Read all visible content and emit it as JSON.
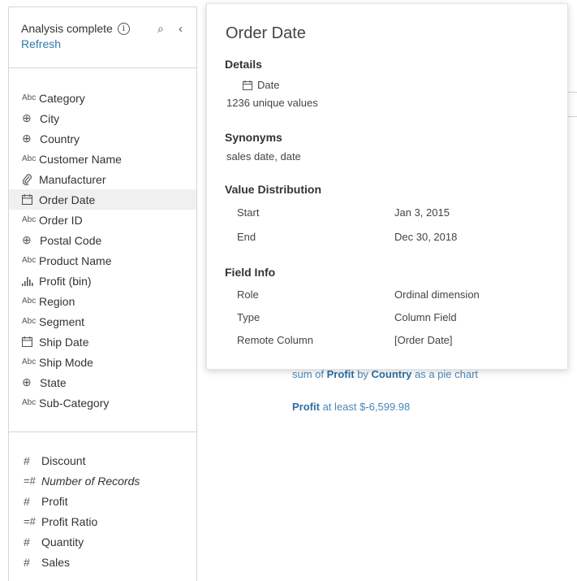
{
  "header": {
    "status": "Analysis complete",
    "refresh_label": "Refresh",
    "icons": [
      "info-icon",
      "search-icon",
      "collapse-icon"
    ]
  },
  "dimensions": [
    {
      "type": "abc",
      "label": "Category"
    },
    {
      "type": "globe",
      "label": "City"
    },
    {
      "type": "globe",
      "label": "Country"
    },
    {
      "type": "abc",
      "label": "Customer Name"
    },
    {
      "type": "paperclip",
      "label": "Manufacturer"
    },
    {
      "type": "calendar",
      "label": "Order Date",
      "selected": true
    },
    {
      "type": "abc",
      "label": "Order ID"
    },
    {
      "type": "globe",
      "label": "Postal Code"
    },
    {
      "type": "abc",
      "label": "Product Name"
    },
    {
      "type": "bin",
      "label": "Profit (bin)"
    },
    {
      "type": "abc",
      "label": "Region"
    },
    {
      "type": "abc",
      "label": "Segment"
    },
    {
      "type": "calendar",
      "label": "Ship Date"
    },
    {
      "type": "abc",
      "label": "Ship Mode"
    },
    {
      "type": "globe",
      "label": "State"
    },
    {
      "type": "abc",
      "label": "Sub-Category"
    }
  ],
  "abc_glyph": "Abc",
  "measures": [
    {
      "type": "hash",
      "label": "Discount"
    },
    {
      "type": "calc-hash",
      "label": "Number of Records",
      "italic": true
    },
    {
      "type": "hash",
      "label": "Profit"
    },
    {
      "type": "calc-hash",
      "label": "Profit Ratio"
    },
    {
      "type": "hash",
      "label": "Quantity"
    },
    {
      "type": "hash",
      "label": "Sales"
    }
  ],
  "popup": {
    "title": "Order Date",
    "details_heading": "Details",
    "data_type": "Date",
    "unique_values": "1236 unique values",
    "synonyms_heading": "Synonyms",
    "synonyms": "sales date, date",
    "distribution_heading": "Value Distribution",
    "distribution": [
      {
        "label": "Start",
        "value": "Jan 3, 2015"
      },
      {
        "label": "End",
        "value": "Dec 30, 2018"
      }
    ],
    "field_info_heading": "Field Info",
    "field_info": [
      {
        "label": "Role",
        "value": "Ordinal dimension"
      },
      {
        "label": "Type",
        "value": "Column Field"
      },
      {
        "label": "Remote Column",
        "value": "[Order Date]"
      }
    ]
  },
  "suggestions": {
    "s1_pre": "sum of ",
    "s1_b1": "Profit",
    "s1_mid": " by ",
    "s1_b2": "Country",
    "s1_post": " as a pie chart",
    "s2_b": "Profit",
    "s2_post": " at least $-6,599.98"
  },
  "colors": {
    "link": "#2d7ba8",
    "suggestion": "#4a87b8",
    "selected_row": "#f0f0f0"
  }
}
